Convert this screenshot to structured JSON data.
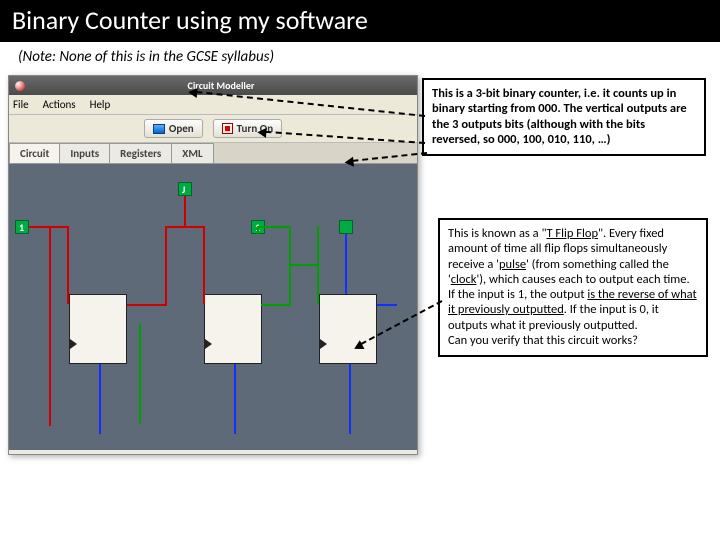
{
  "slide": {
    "title": "Binary Counter using my software",
    "subtitle": "(Note: None of this is in the GCSE syllabus)"
  },
  "app": {
    "window_title": "Circuit Modeller",
    "menu": {
      "file": "File",
      "actions": "Actions",
      "help": "Help"
    },
    "toolbar": {
      "open": "Open",
      "turn_on": "Turn On"
    },
    "tabs": {
      "circuit": "Circuit",
      "inputs": "Inputs",
      "registers": "Registers",
      "xml": "XML"
    },
    "labels": {
      "j": "J",
      "one1": "1",
      "one2": "1"
    }
  },
  "callouts": {
    "top": "This is a 3-bit binary counter, i.e. it counts up in binary starting from 000. The vertical outputs are the 3 outputs bits (although with the bits reversed, so 000, 100, 010, 110, …)",
    "bottom_p1": "This is known as a \"",
    "bottom_link": "T Flip Flop",
    "bottom_p2": "\". Every fixed amount of time all flip flops simultaneously receive a '",
    "bottom_pulse": "pulse",
    "bottom_p3": "' (from something called the '",
    "bottom_clock": "clock",
    "bottom_p4": "'), which causes each to output each time. If the input is 1, the output ",
    "bottom_reverse": "is the reverse of what it previously outputted",
    "bottom_p5": ". If the input is 0, it outputs what it previously outputted.",
    "bottom_q": "Can you verify that this circuit works?"
  }
}
